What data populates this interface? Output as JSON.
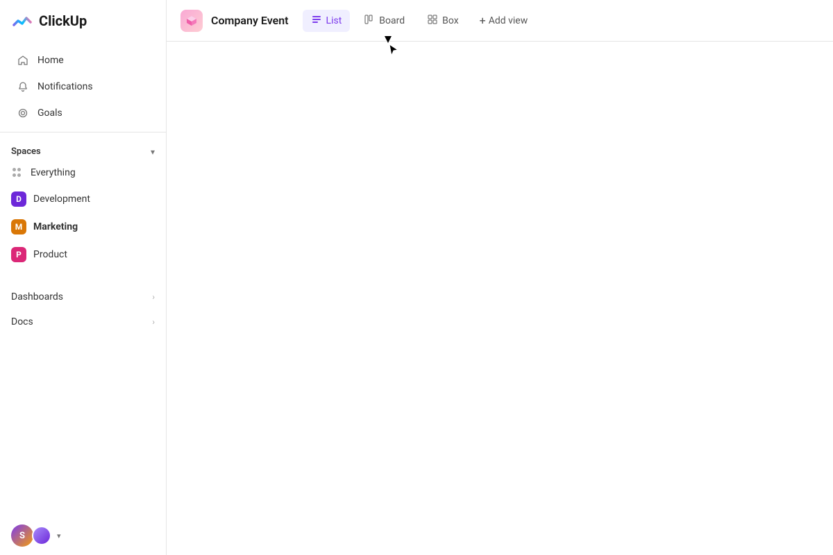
{
  "app": {
    "name": "ClickUp"
  },
  "sidebar": {
    "nav": [
      {
        "id": "home",
        "label": "Home",
        "icon": "⌂"
      },
      {
        "id": "notifications",
        "label": "Notifications",
        "icon": "🔔"
      },
      {
        "id": "goals",
        "label": "Goals",
        "icon": "◎"
      }
    ],
    "spaces_title": "Spaces",
    "spaces": [
      {
        "id": "everything",
        "label": "Everything",
        "type": "dots"
      },
      {
        "id": "development",
        "label": "Development",
        "type": "avatar",
        "color": "#6d28d9",
        "letter": "D"
      },
      {
        "id": "marketing",
        "label": "Marketing",
        "type": "avatar",
        "color": "#d97706",
        "letter": "M",
        "bold": true
      },
      {
        "id": "product",
        "label": "Product",
        "type": "avatar",
        "color": "#db2777",
        "letter": "P"
      }
    ],
    "bottom_nav": [
      {
        "id": "dashboards",
        "label": "Dashboards"
      },
      {
        "id": "docs",
        "label": "Docs"
      }
    ],
    "footer": {
      "initials": "S",
      "chevron": "▾"
    }
  },
  "topbar": {
    "project_title": "Company Event",
    "views": [
      {
        "id": "list",
        "label": "List",
        "active": true
      },
      {
        "id": "board",
        "label": "Board",
        "active": false
      },
      {
        "id": "box",
        "label": "Box",
        "active": false
      }
    ],
    "add_view_label": "Add view"
  }
}
